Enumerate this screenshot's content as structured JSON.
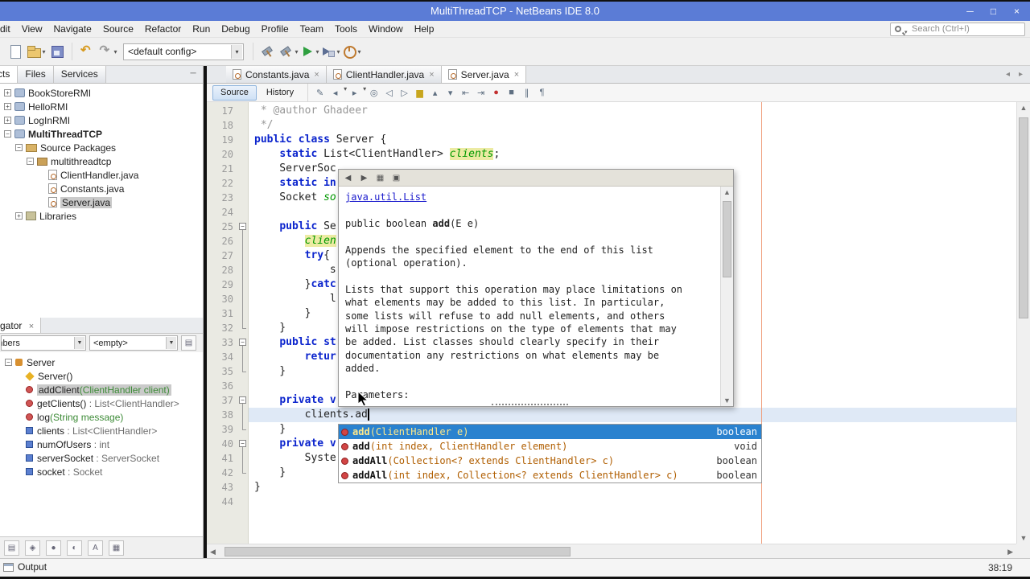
{
  "window": {
    "title": "MultiThreadTCP - NetBeans IDE 8.0",
    "controls": [
      "minimize",
      "maximize",
      "close"
    ]
  },
  "menubar": {
    "items": [
      "Edit",
      "View",
      "Navigate",
      "Source",
      "Refactor",
      "Run",
      "Debug",
      "Profile",
      "Team",
      "Tools",
      "Window",
      "Help"
    ],
    "search_placeholder": "Search (Ctrl+I)"
  },
  "toolbar": {
    "file_icons": [
      "new-file",
      "open-project",
      "save-all"
    ],
    "edit_icons": [
      "undo",
      "redo"
    ],
    "config_value": "<default config>",
    "run_icons": [
      "build",
      "clean-build",
      "run",
      "debug",
      "profile"
    ]
  },
  "projects": {
    "tabs": [
      {
        "label": "Projects",
        "active": true
      },
      {
        "label": "Files",
        "active": false
      },
      {
        "label": "Services",
        "active": false
      }
    ],
    "items": [
      {
        "label": "BookStoreRMI",
        "level": 0,
        "icon": "project",
        "handle": "plus"
      },
      {
        "label": "HelloRMI",
        "level": 0,
        "icon": "project",
        "handle": "plus"
      },
      {
        "label": "LogInRMI",
        "level": 0,
        "icon": "project",
        "handle": "plus"
      },
      {
        "label": "MultiThreadTCP",
        "level": 0,
        "icon": "project",
        "handle": "minus",
        "bold": true
      },
      {
        "label": "Source Packages",
        "level": 1,
        "icon": "source-folder",
        "handle": "minus"
      },
      {
        "label": "multithreadtcp",
        "level": 2,
        "icon": "package",
        "handle": "minus"
      },
      {
        "label": "ClientHandler.java",
        "level": 3,
        "icon": "java-file"
      },
      {
        "label": "Constants.java",
        "level": 3,
        "icon": "java-file"
      },
      {
        "label": "Server.java",
        "level": 3,
        "icon": "java-file",
        "selected": true
      },
      {
        "label": "Libraries",
        "level": 1,
        "icon": "libraries",
        "handle": "plus"
      }
    ]
  },
  "navigator": {
    "tab_label": "Navigator",
    "close_glyph": "×",
    "filter1": "Members",
    "filter2": "<empty>",
    "filter_buttons": [
      "show-inherited",
      "show-fields",
      "show-static",
      "show-non-public",
      "sort-alpha",
      "sort-source"
    ],
    "items": [
      {
        "name": "Server",
        "kind": "class",
        "level": 0,
        "handle": "minus"
      },
      {
        "name": "Server()",
        "kind": "constructor",
        "level": 1
      },
      {
        "name": "addClient",
        "args": "(ClientHandler client)",
        "kind": "method",
        "level": 1,
        "selected": true
      },
      {
        "name": "getClients()",
        "type": " : List<ClientHandler>",
        "kind": "method",
        "level": 1
      },
      {
        "name": "log",
        "args": "(String message)",
        "kind": "method",
        "level": 1
      },
      {
        "name": "clients",
        "type": " : List<ClientHandler>",
        "kind": "field",
        "level": 1
      },
      {
        "name": "numOfUsers",
        "type": " : int",
        "kind": "field",
        "level": 1
      },
      {
        "name": "serverSocket",
        "type": " : ServerSocket",
        "kind": "field",
        "level": 1
      },
      {
        "name": "socket",
        "type": " : Socket",
        "kind": "field",
        "level": 1
      }
    ]
  },
  "editor": {
    "tabs": [
      {
        "label": "Constants.java",
        "active": false
      },
      {
        "label": "ClientHandler.java",
        "active": false
      },
      {
        "label": "Server.java",
        "active": true
      }
    ],
    "source_btn": "Source",
    "history_btn": "History",
    "toolbar_icons": [
      "last-edit",
      "back",
      "forward",
      "find-selection",
      "find-previous",
      "find-next",
      "toggle-highlight",
      "previous-bookmark",
      "next-bookmark",
      "shift-left",
      "shift-right",
      "start-macro",
      "stop-macro",
      "comment",
      "uncomment"
    ],
    "caret_status": "38:19",
    "caret_line": 38,
    "caret_col": 19,
    "fold_ranges": [
      [
        25,
        32
      ],
      [
        33,
        35
      ],
      [
        37,
        39
      ],
      [
        40,
        42
      ]
    ],
    "lines": [
      {
        "n": 17,
        "segs": [
          [
            " * @author Ghadeer",
            "cm"
          ]
        ]
      },
      {
        "n": 18,
        "segs": [
          [
            " */",
            "cm"
          ]
        ]
      },
      {
        "n": 19,
        "segs": [
          [
            "public",
            "kw"
          ],
          [
            " ",
            ""
          ],
          [
            "class",
            "kw"
          ],
          [
            " Server {",
            ""
          ]
        ]
      },
      {
        "n": 20,
        "segs": [
          [
            "    ",
            ""
          ],
          [
            "static",
            "kw"
          ],
          [
            " List<ClientHandler> ",
            ""
          ],
          [
            "clients",
            "fld hl"
          ],
          [
            ";",
            ""
          ]
        ]
      },
      {
        "n": 21,
        "segs": [
          [
            "    ServerSoc",
            ""
          ]
        ]
      },
      {
        "n": 22,
        "segs": [
          [
            "    ",
            ""
          ],
          [
            "static",
            "kw"
          ],
          [
            " in",
            "kw"
          ]
        ]
      },
      {
        "n": 23,
        "segs": [
          [
            "    Socket ",
            ""
          ],
          [
            "so",
            "fld"
          ]
        ]
      },
      {
        "n": 24,
        "segs": []
      },
      {
        "n": 25,
        "fold": true,
        "segs": [
          [
            "    ",
            ""
          ],
          [
            "public",
            "kw"
          ],
          [
            " Se",
            ""
          ]
        ]
      },
      {
        "n": 26,
        "segs": [
          [
            "        ",
            ""
          ],
          [
            "clien",
            "fld hl"
          ]
        ]
      },
      {
        "n": 27,
        "segs": [
          [
            "        ",
            ""
          ],
          [
            "try",
            "kw"
          ],
          [
            "{",
            ""
          ]
        ]
      },
      {
        "n": 28,
        "segs": [
          [
            "            s",
            ""
          ]
        ]
      },
      {
        "n": 29,
        "segs": [
          [
            "        }",
            ""
          ],
          [
            "catc",
            "kw"
          ]
        ]
      },
      {
        "n": 30,
        "segs": [
          [
            "            l",
            ""
          ]
        ]
      },
      {
        "n": 31,
        "segs": [
          [
            "        }",
            ""
          ]
        ]
      },
      {
        "n": 32,
        "segs": [
          [
            "    }",
            ""
          ]
        ]
      },
      {
        "n": 33,
        "fold": true,
        "segs": [
          [
            "    ",
            ""
          ],
          [
            "public",
            "kw"
          ],
          [
            " ",
            ""
          ],
          [
            "st",
            "kw"
          ]
        ]
      },
      {
        "n": 34,
        "segs": [
          [
            "        ",
            ""
          ],
          [
            "retur",
            "kw"
          ]
        ]
      },
      {
        "n": 35,
        "segs": [
          [
            "    }",
            ""
          ]
        ]
      },
      {
        "n": 36,
        "segs": []
      },
      {
        "n": 37,
        "fold": true,
        "segs": [
          [
            "    ",
            ""
          ],
          [
            "private",
            "kw"
          ],
          [
            " v",
            "kw"
          ]
        ]
      },
      {
        "n": 38,
        "current": true,
        "caret": true,
        "segs": [
          [
            "        clients.ad",
            ""
          ]
        ]
      },
      {
        "n": 39,
        "segs": [
          [
            "    }",
            ""
          ]
        ]
      },
      {
        "n": 40,
        "fold": true,
        "segs": [
          [
            "    ",
            ""
          ],
          [
            "private",
            "kw"
          ],
          [
            " v",
            "kw"
          ]
        ]
      },
      {
        "n": 41,
        "segs": [
          [
            "        Syste",
            ""
          ]
        ]
      },
      {
        "n": 42,
        "segs": [
          [
            "    }",
            ""
          ]
        ]
      },
      {
        "n": 43,
        "segs": [
          [
            "}",
            ""
          ]
        ]
      },
      {
        "n": 44,
        "segs": []
      }
    ]
  },
  "javadoc": {
    "toolbar_icons": [
      "back",
      "forward",
      "show-in-browser",
      "copy"
    ],
    "link": "java.util.List",
    "sig_pre": "public boolean ",
    "sig_name": "add",
    "sig_args": "(E e)",
    "para1": [
      "Appends the specified element to the end of this list",
      "(optional operation)."
    ],
    "para2": [
      "Lists that support this operation may place limitations on",
      "what elements may be added to this list. In particular,",
      "some lists will refuse to add null elements, and others",
      "will impose restrictions on the type of elements that may",
      "be added. List classes should clearly specify in their",
      "documentation any restrictions on what elements may be",
      "added."
    ],
    "params_label": "Parameters:"
  },
  "completion": {
    "rows": [
      {
        "name": "add",
        "params": "(ClientHandler e)",
        "ret": "boolean",
        "selected": true
      },
      {
        "name": "add",
        "params": "(int index, ClientHandler element)",
        "ret": "void",
        "selected": false
      },
      {
        "name": "addAll",
        "params": "(Collection<? extends ClientHandler> c)",
        "ret": "boolean",
        "selected": false
      },
      {
        "name": "addAll",
        "params": "(int index, Collection<? extends ClientHandler> c)",
        "ret": "boolean",
        "selected": false
      }
    ]
  },
  "statusbar": {
    "output": "Output"
  }
}
